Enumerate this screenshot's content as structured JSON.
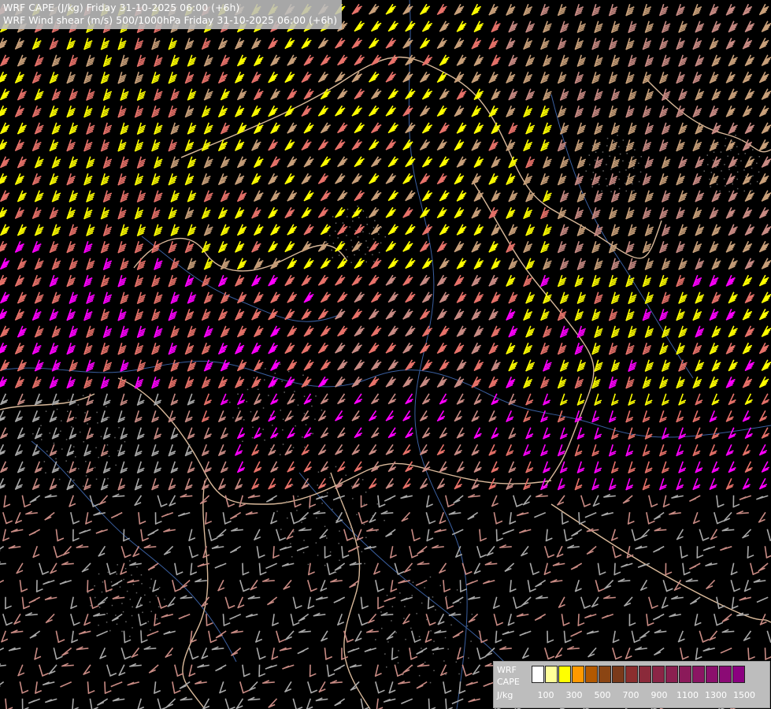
{
  "title": {
    "line1": "WRF CAPE (J/kg) Friday 31-10-2025 06:00 (+6h)",
    "line2": "WRF Wind shear (m/s) 500/1000hPa Friday 31-10-2025 06:00 (+6h)"
  },
  "legend": {
    "line1": "WRF",
    "line2": "CAPE",
    "line3": "J/kg",
    "colors": [
      "#ffffff",
      "#ffff99",
      "#ffff00",
      "#ff9900",
      "#b35900",
      "#8b4513",
      "#7a3a1a",
      "#8b2e2e",
      "#8b2a3a",
      "#8b2546",
      "#8b2050",
      "#8b1a5a",
      "#8b1563",
      "#8b106c",
      "#8b0a75",
      "#8b0080"
    ],
    "tick_labels": [
      "100",
      "300",
      "500",
      "700",
      "900",
      "1100",
      "1300",
      "1500"
    ]
  },
  "barb_palette": {
    "gray": "#a9a9a9",
    "rose": "#c98b84",
    "salmon": "#e8726a",
    "tan": "#c9a07a",
    "yellow": "#ffff00",
    "magenta": "#ff00ff"
  },
  "map_colors": {
    "background": "#000000",
    "border": "#d9b99a",
    "river": "#3a5fa0"
  }
}
